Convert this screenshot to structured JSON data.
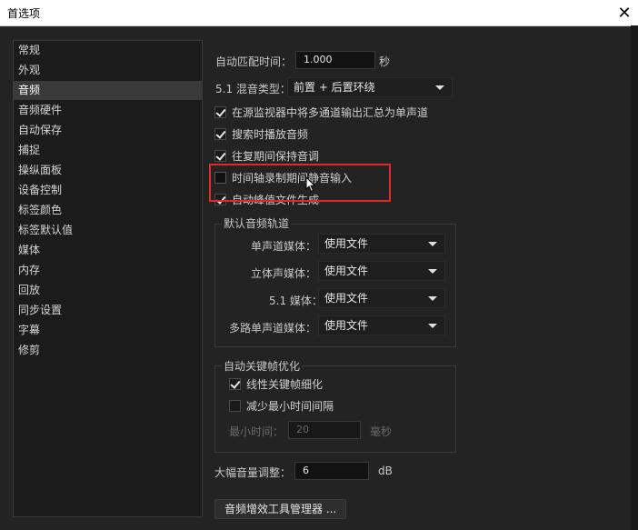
{
  "window": {
    "title": "首选项",
    "close_label": "✕"
  },
  "sidebar": {
    "items": [
      {
        "label": "常规"
      },
      {
        "label": "外观"
      },
      {
        "label": "音频",
        "active": true
      },
      {
        "label": "音频硬件"
      },
      {
        "label": "自动保存"
      },
      {
        "label": "捕捉"
      },
      {
        "label": "操纵面板"
      },
      {
        "label": "设备控制"
      },
      {
        "label": "标签颜色"
      },
      {
        "label": "标签默认值"
      },
      {
        "label": "媒体"
      },
      {
        "label": "内存"
      },
      {
        "label": "回放"
      },
      {
        "label": "同步设置"
      },
      {
        "label": "字幕"
      },
      {
        "label": "修剪"
      }
    ]
  },
  "audio": {
    "auto_match": {
      "label": "自动匹配时间：",
      "value": "1.000",
      "unit": "秒"
    },
    "mix_type": {
      "label": "5.1 混音类型：",
      "value": "前置 + 后置环绕"
    },
    "options": [
      {
        "label": "在源监视器中将多通道输出汇总为单声道",
        "checked": true
      },
      {
        "label": "搜索时播放音频",
        "checked": true
      },
      {
        "label": "往复期间保持音调",
        "checked": true
      },
      {
        "label": "时间轴录制期间静音输入",
        "checked": false
      },
      {
        "label": "自动峰值文件生成",
        "checked": true
      }
    ],
    "default_tracks": {
      "title": "默认音频轨道",
      "rows": [
        {
          "label": "单声道媒体：",
          "value": "使用文件"
        },
        {
          "label": "立体声媒体：",
          "value": "使用文件"
        },
        {
          "label": "5.1 媒体：",
          "value": "使用文件"
        },
        {
          "label": "多路单声道媒体：",
          "value": "使用文件"
        }
      ]
    },
    "keyframe": {
      "title": "自动关键帧优化",
      "linear": {
        "label": "线性关键帧细化",
        "checked": true
      },
      "reduce": {
        "label": "减少最小时间间隔",
        "checked": false
      },
      "min_time": {
        "label": "最小时间：",
        "value": "20",
        "unit": "毫秒"
      }
    },
    "gain": {
      "label": "大幅音量调整：",
      "value": "6",
      "unit": "dB"
    },
    "plugin_manager_label": "音频增效工具管理器 ..."
  },
  "colors": {
    "highlight": "#e02a2a",
    "background": "#232323"
  }
}
